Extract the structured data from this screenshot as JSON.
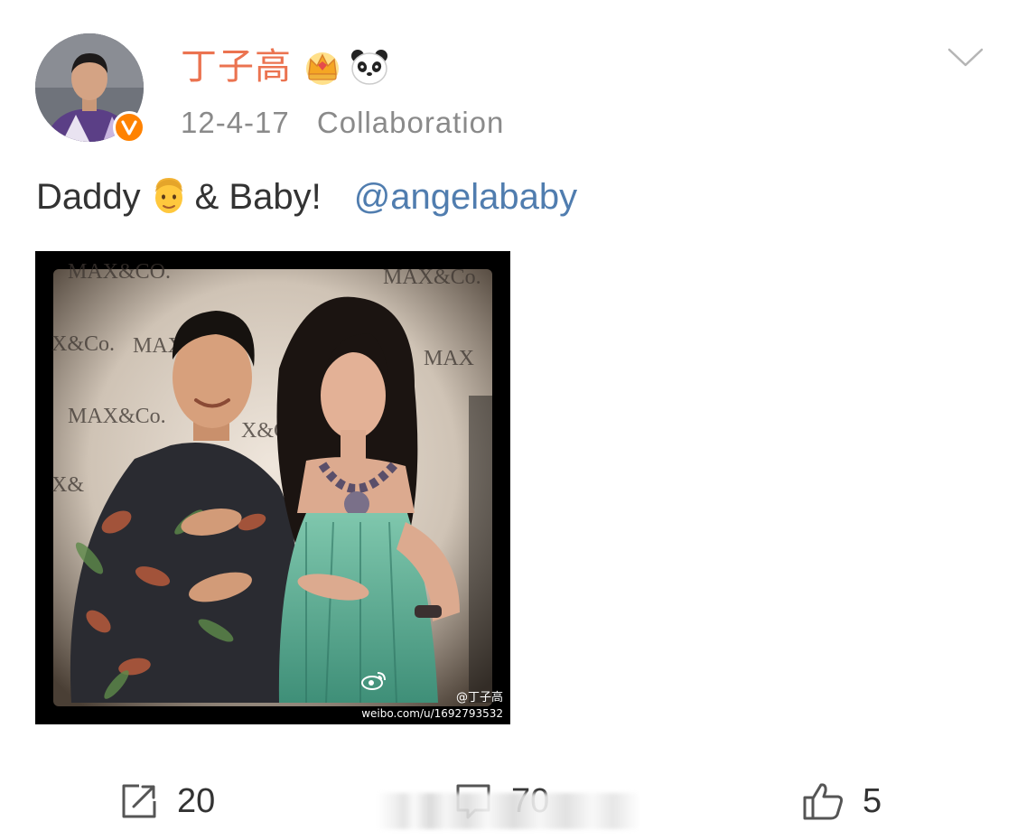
{
  "post": {
    "author": {
      "name": "丁子高",
      "avatar_icon": "avatar-photo",
      "verified_icon": "verified-v-icon",
      "badges": [
        "crown-badge-icon",
        "panda-badge-icon"
      ]
    },
    "date": "12-4-17",
    "source": "Collaboration",
    "text_before_emoji": "Daddy",
    "emoji": "man-emoji-icon",
    "text_after_emoji": "& Baby!",
    "mention": "@angelababy",
    "image": {
      "description_icon": "photo-image",
      "watermark_handle": "@丁子高",
      "watermark_url": "weibo.com/u/1692793532"
    }
  },
  "actions": {
    "repost_count": "20",
    "comment_count": "70",
    "like_count": "5"
  },
  "colors": {
    "username": "#eb7350",
    "mention": "#507daf",
    "meta": "#8a8a8a",
    "verified": "#ff8200"
  }
}
